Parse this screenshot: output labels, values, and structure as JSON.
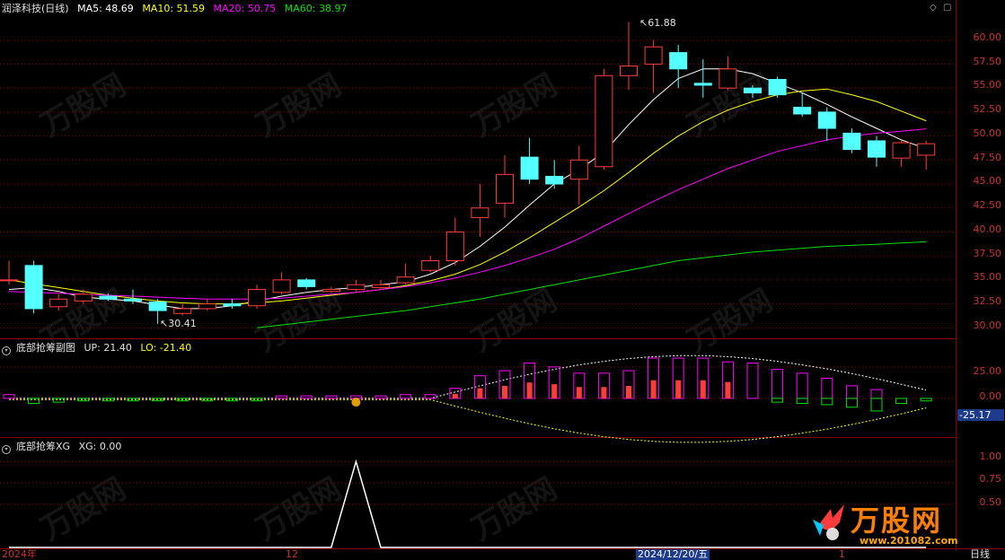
{
  "main_header": {
    "stock": "润泽科技",
    "period": "(日线)",
    "ma5": "MA5: 48.69",
    "ma10": "MA10: 51.59",
    "ma20": "MA20: 50.75",
    "ma60": "MA60: 38.97"
  },
  "sub1_header": {
    "title": "底部抢筹副图",
    "up": "UP: 21.40",
    "lo": "LO: -21.40"
  },
  "sub2_header": {
    "title": "底部抢筹XG",
    "xg": "XG: 0.00"
  },
  "annotations": {
    "high": "61.88",
    "low": "30.41",
    "sub1_current": "-25.17"
  },
  "price_axis": [
    "60.00",
    "57.50",
    "55.00",
    "52.50",
    "50.00",
    "47.50",
    "45.00",
    "42.50",
    "40.00",
    "37.50",
    "35.00",
    "32.50",
    "30.00"
  ],
  "sub1_axis": [
    "25.00",
    "0.00"
  ],
  "sub2_axis": [
    "1.00",
    "0.75",
    "0.50"
  ],
  "date_axis": {
    "left": "2024年",
    "mid": "12",
    "cursor": "2024/12/20/五",
    "right": "1",
    "period": "日线"
  },
  "watermark": {
    "brand": "万股网",
    "url": "www.201082.com"
  },
  "colors": {
    "up": "#ff3c3c",
    "down": "#54ffff",
    "ma5": "#ffffff",
    "ma10": "#ffff00",
    "ma20": "#ff00ff",
    "ma60": "#00e000",
    "grid": "#8b0000"
  },
  "chart_data": [
    {
      "type": "candlestick",
      "title": "润泽科技 (日线)",
      "ylim": [
        29,
        62.5
      ],
      "candles": [
        {
          "o": 35.0,
          "c": 35.0,
          "h": 37.0,
          "l": 34.5
        },
        {
          "o": 36.5,
          "c": 32.0,
          "h": 37.0,
          "l": 31.5
        },
        {
          "o": 32.2,
          "c": 33.0,
          "h": 33.5,
          "l": 31.8
        },
        {
          "o": 32.8,
          "c": 33.5,
          "h": 34.0,
          "l": 32.5
        },
        {
          "o": 33.3,
          "c": 33.0,
          "h": 33.6,
          "l": 32.8
        },
        {
          "o": 33.0,
          "c": 32.8,
          "h": 34.0,
          "l": 32.5
        },
        {
          "o": 32.7,
          "c": 31.8,
          "h": 33.0,
          "l": 30.41
        },
        {
          "o": 31.5,
          "c": 32.0,
          "h": 32.5,
          "l": 31.3
        },
        {
          "o": 32.0,
          "c": 32.5,
          "h": 33.0,
          "l": 31.8
        },
        {
          "o": 32.5,
          "c": 32.3,
          "h": 33.0,
          "l": 32.0
        },
        {
          "o": 32.3,
          "c": 34.0,
          "h": 34.5,
          "l": 32.0
        },
        {
          "o": 33.7,
          "c": 35.0,
          "h": 35.8,
          "l": 33.5
        },
        {
          "o": 35.0,
          "c": 34.3,
          "h": 35.2,
          "l": 34.0
        },
        {
          "o": 33.8,
          "c": 34.0,
          "h": 34.3,
          "l": 33.7
        },
        {
          "o": 34.0,
          "c": 34.5,
          "h": 35.0,
          "l": 33.8
        },
        {
          "o": 34.2,
          "c": 34.5,
          "h": 35.0,
          "l": 34.0
        },
        {
          "o": 34.7,
          "c": 35.3,
          "h": 36.7,
          "l": 34.5
        },
        {
          "o": 36.0,
          "c": 37.0,
          "h": 37.5,
          "l": 35.8
        },
        {
          "o": 37.0,
          "c": 40.0,
          "h": 41.5,
          "l": 36.5
        },
        {
          "o": 41.5,
          "c": 42.5,
          "h": 45.0,
          "l": 39.5
        },
        {
          "o": 43.0,
          "c": 46.0,
          "h": 48.0,
          "l": 41.5
        },
        {
          "o": 47.8,
          "c": 45.5,
          "h": 49.8,
          "l": 45.0
        },
        {
          "o": 45.8,
          "c": 45.0,
          "h": 47.5,
          "l": 44.5
        },
        {
          "o": 45.5,
          "c": 47.5,
          "h": 49.0,
          "l": 42.8
        },
        {
          "o": 46.8,
          "c": 56.3,
          "h": 57.0,
          "l": 46.5
        },
        {
          "o": 56.3,
          "c": 57.3,
          "h": 61.88,
          "l": 54.8
        },
        {
          "o": 57.5,
          "c": 59.3,
          "h": 60.0,
          "l": 54.5
        },
        {
          "o": 58.7,
          "c": 57.0,
          "h": 59.5,
          "l": 55.0
        },
        {
          "o": 55.5,
          "c": 55.3,
          "h": 58.0,
          "l": 54.0
        },
        {
          "o": 55.0,
          "c": 57.0,
          "h": 58.3,
          "l": 54.8
        },
        {
          "o": 55.0,
          "c": 54.5,
          "h": 55.3,
          "l": 54.0
        },
        {
          "o": 55.9,
          "c": 54.3,
          "h": 56.2,
          "l": 54.0
        },
        {
          "o": 53.0,
          "c": 52.3,
          "h": 54.5,
          "l": 52.0
        },
        {
          "o": 52.5,
          "c": 50.8,
          "h": 53.0,
          "l": 49.5
        },
        {
          "o": 50.3,
          "c": 48.6,
          "h": 50.8,
          "l": 48.2
        },
        {
          "o": 49.5,
          "c": 47.8,
          "h": 50.0,
          "l": 46.8
        },
        {
          "o": 47.7,
          "c": 49.3,
          "h": 49.5,
          "l": 46.8
        },
        {
          "o": 48.0,
          "c": 49.2,
          "h": 49.5,
          "l": 46.5
        }
      ],
      "series": [
        {
          "name": "MA5",
          "values": [
            34.0,
            34.2,
            33.8,
            33.2,
            33.0,
            32.8,
            32.4,
            32.0,
            32.0,
            32.3,
            32.8,
            33.3,
            33.7,
            34.0,
            34.2,
            34.5,
            34.8,
            35.6,
            36.8,
            38.5,
            40.5,
            42.8,
            45.0,
            46.5,
            48.3,
            51.2,
            53.8,
            56.0,
            57.0,
            57.0,
            56.5,
            55.5,
            54.5,
            53.3,
            52.0,
            50.8,
            49.6,
            48.69
          ]
        },
        {
          "name": "MA10",
          "values": [
            35.0,
            34.6,
            34.2,
            33.8,
            33.4,
            33.1,
            32.8,
            32.6,
            32.5,
            32.5,
            32.6,
            32.8,
            33.1,
            33.4,
            33.7,
            34.0,
            34.4,
            34.9,
            35.6,
            36.6,
            37.9,
            39.4,
            41.0,
            42.6,
            44.3,
            46.2,
            48.2,
            50.0,
            51.5,
            52.7,
            53.6,
            54.3,
            54.7,
            54.9,
            54.3,
            53.6,
            52.6,
            51.59
          ]
        },
        {
          "name": "MA20",
          "values": [
            33.8,
            33.7,
            33.6,
            33.5,
            33.4,
            33.3,
            33.2,
            33.1,
            33.0,
            33.0,
            33.0,
            33.1,
            33.3,
            33.5,
            33.7,
            34.0,
            34.3,
            34.7,
            35.2,
            35.8,
            36.5,
            37.3,
            38.2,
            39.3,
            40.6,
            41.9,
            43.2,
            44.4,
            45.5,
            46.6,
            47.5,
            48.4,
            49.0,
            49.6,
            50.0,
            50.3,
            50.5,
            50.75
          ]
        },
        {
          "name": "MA60",
          "values": [
            null,
            null,
            null,
            null,
            null,
            null,
            null,
            null,
            null,
            null,
            30.0,
            30.3,
            30.6,
            30.9,
            31.2,
            31.5,
            31.8,
            32.2,
            32.6,
            33.0,
            33.5,
            34.0,
            34.5,
            35.0,
            35.5,
            36.0,
            36.5,
            37.0,
            37.3,
            37.6,
            37.9,
            38.1,
            38.3,
            38.5,
            38.6,
            38.7,
            38.85,
            38.97
          ]
        }
      ]
    },
    {
      "type": "bar",
      "title": "底部抢筹副图",
      "ylim": [
        -30,
        37
      ],
      "series": [
        {
          "name": "UP",
          "values": [
            3,
            0,
            0,
            0,
            0,
            0,
            0,
            0,
            0,
            0,
            0,
            2,
            2,
            2,
            2,
            2,
            3,
            3,
            8,
            18,
            22,
            28,
            25,
            20,
            20,
            22,
            32,
            32,
            32,
            29,
            28,
            23,
            20,
            16,
            10,
            7,
            0,
            -2
          ]
        },
        {
          "name": "LO",
          "values": [
            0,
            -4,
            -3,
            -2,
            -2,
            -2,
            -2,
            -2,
            -2,
            -2,
            -2,
            0,
            0,
            0,
            0,
            0,
            0,
            0,
            0,
            0,
            0,
            0,
            0,
            0,
            0,
            0,
            0,
            0,
            0,
            0,
            0,
            -3,
            -4,
            -5,
            -7,
            -10,
            -4,
            -2
          ]
        }
      ]
    },
    {
      "type": "line",
      "title": "底部抢筹XG",
      "ylim": [
        0,
        1.15
      ],
      "series": [
        {
          "name": "XG",
          "values": [
            0,
            0,
            0,
            0,
            0,
            0,
            0,
            0,
            0,
            0,
            0,
            0,
            0,
            0,
            1,
            0,
            0,
            0,
            0,
            0,
            0,
            0,
            0,
            0,
            0,
            0,
            0,
            0,
            0,
            0,
            0,
            0,
            0,
            0,
            0,
            0,
            0,
            0
          ]
        }
      ]
    }
  ]
}
